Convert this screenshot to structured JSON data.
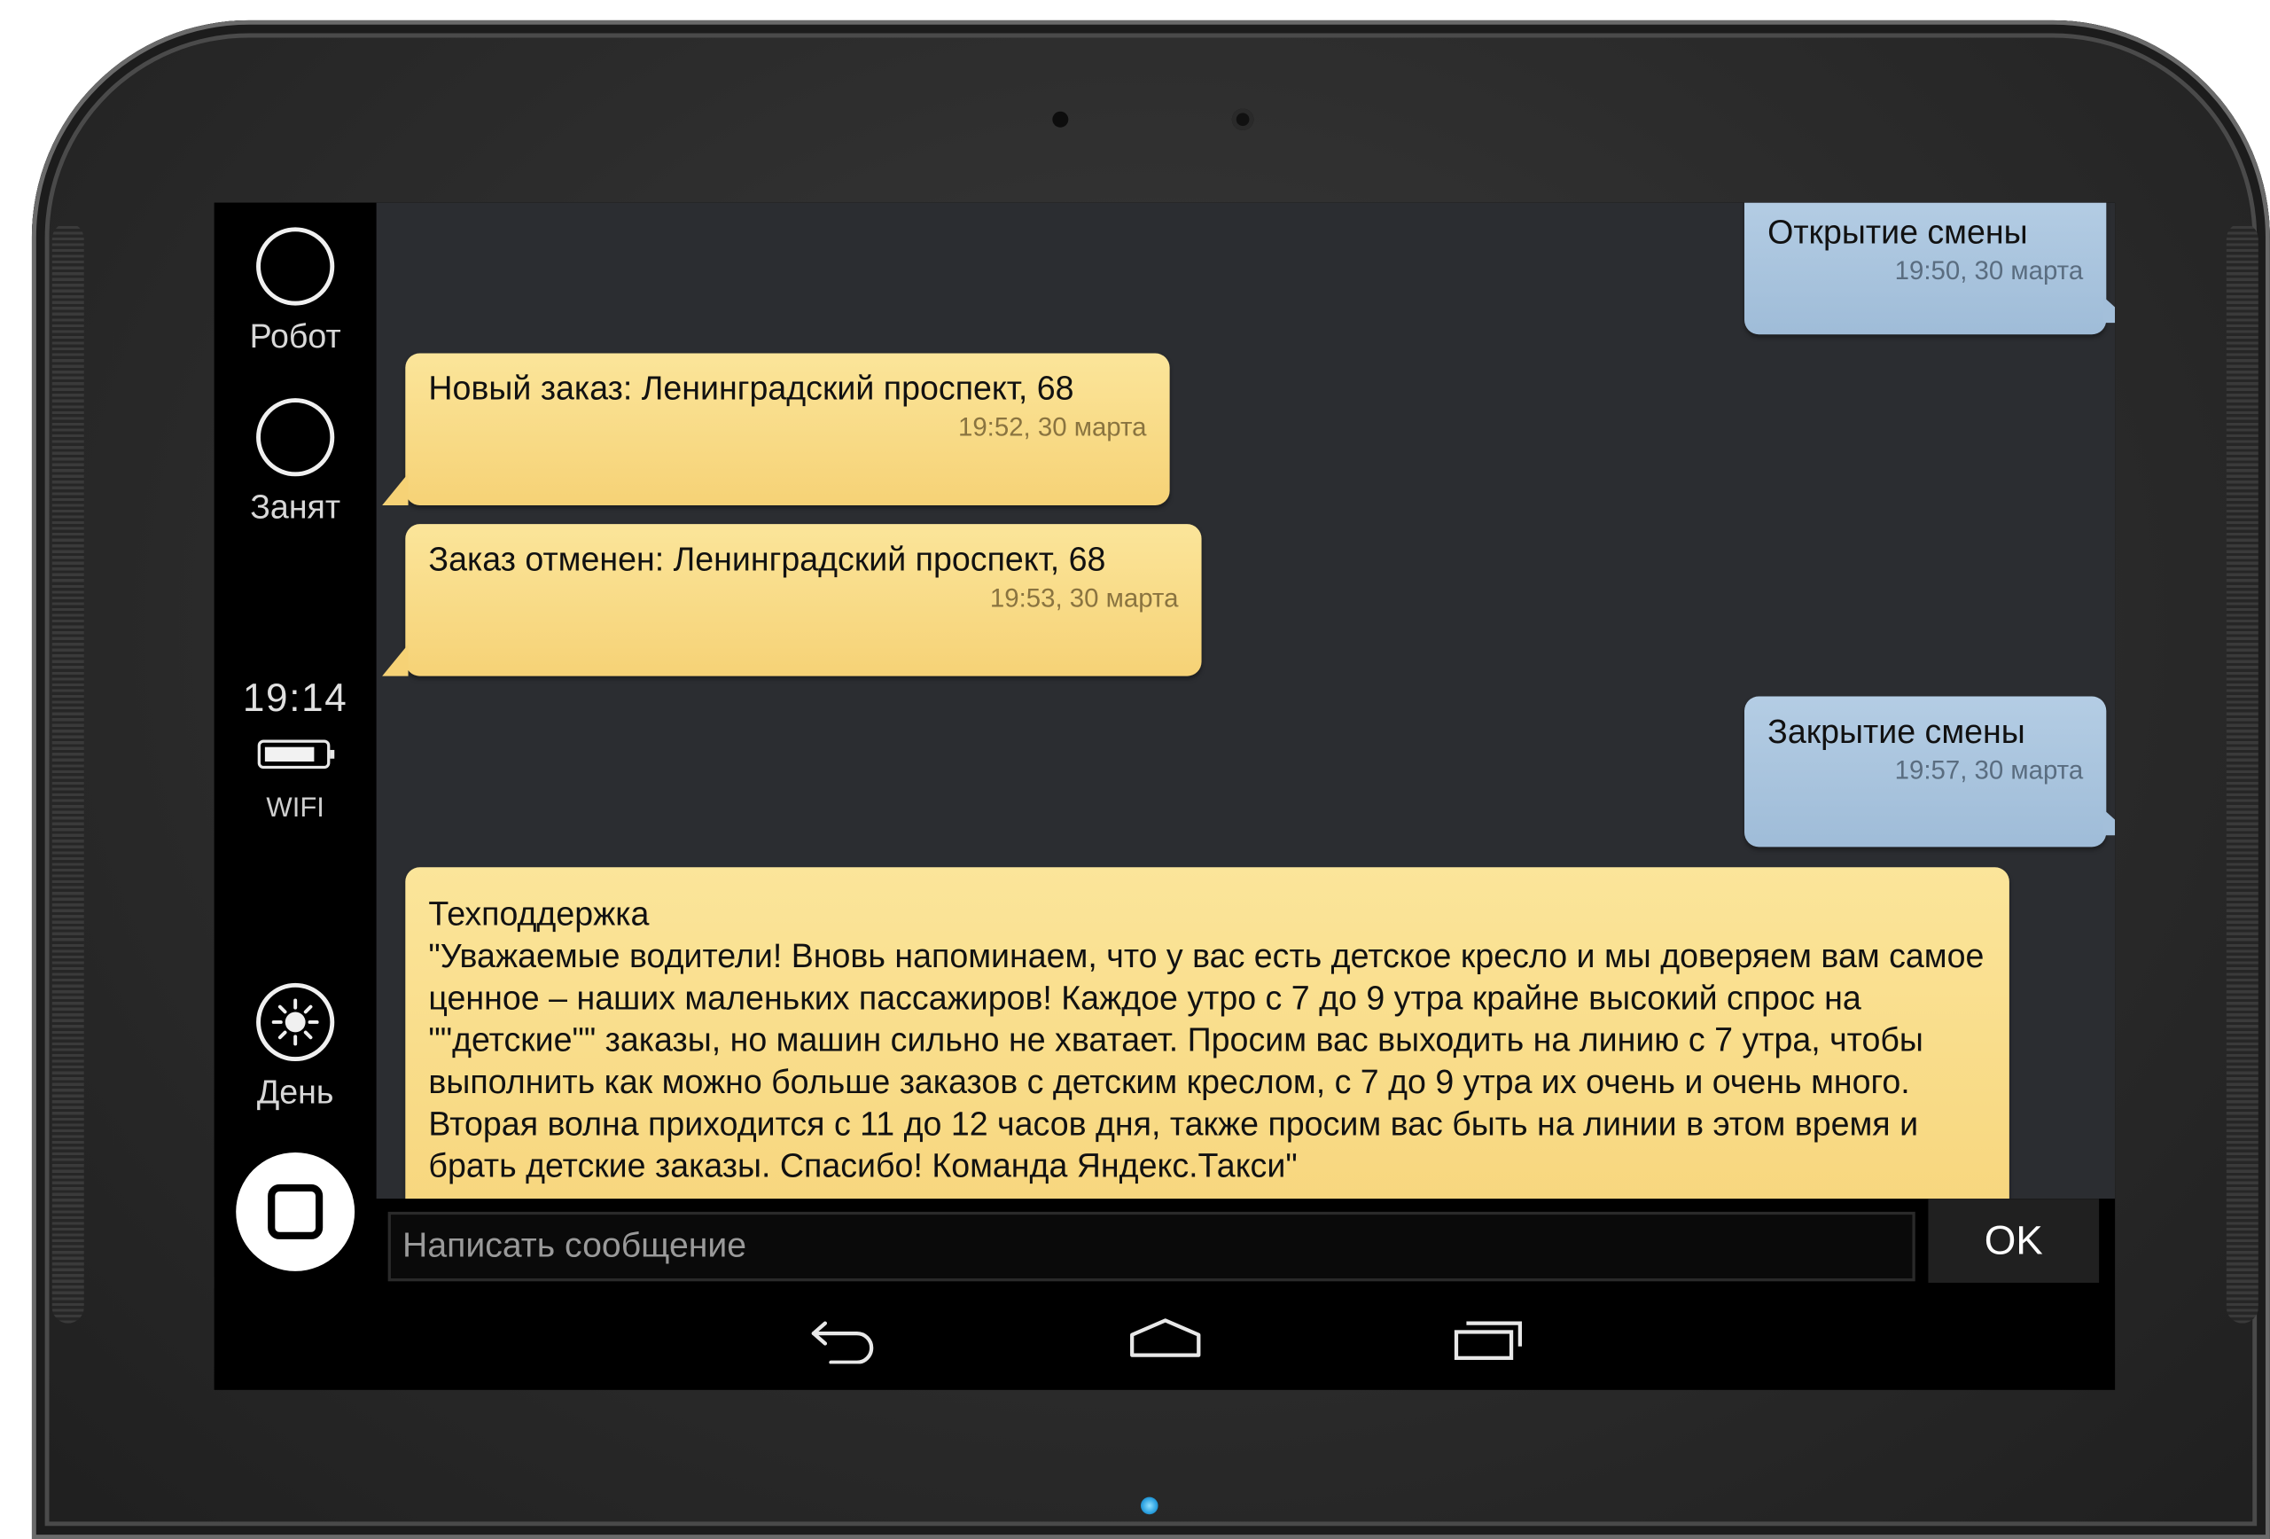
{
  "sidebar": {
    "robot_label": "Робот",
    "busy_label": "Занят",
    "time": "19:14",
    "network": "WIFI",
    "day_label": "День"
  },
  "messages": [
    {
      "direction": "outgoing",
      "text": "Открытие смены",
      "time": "19:50, 30 марта"
    },
    {
      "direction": "incoming",
      "text": "Новый заказ: Ленинградский проспект, 68",
      "time": "19:52, 30 марта"
    },
    {
      "direction": "incoming",
      "text": "Заказ отменен: Ленинградский проспект, 68",
      "time": "19:53, 30 марта"
    },
    {
      "direction": "outgoing",
      "text": "Закрытие смены",
      "time": "19:57, 30 марта"
    },
    {
      "direction": "incoming",
      "sender": "Техподдержка",
      "text": "\"Уважаемые водители! Вновь напоминаем, что у вас есть детское кресло и мы доверяем вам самое ценное – наших маленьких пассажиров! Каждое утро с 7 до 9 утра крайне высокий спрос на \"\"детские\"\" заказы, но машин сильно не хватает. Просим вас выходить на линию с 7 утра, чтобы выполнить как можно больше заказов с детским креслом, с 7 до 9 утра их очень и очень много. Вторая волна приходится с 11 до 12 часов дня, также просим вас быть на линии в этом время и брать детские заказы. Спасибо! Команда Яндекс.Такси\""
    }
  ],
  "composer": {
    "placeholder": "Написать сообщение",
    "send_label": "OK"
  },
  "icons": {
    "robot": "circle-icon",
    "busy": "circle-icon",
    "day": "sun-icon",
    "stop": "stop-icon",
    "back": "back-icon",
    "home": "home-icon",
    "recents": "recents-icon"
  },
  "colors": {
    "incoming_bubble": "#f6d276",
    "outgoing_bubble": "#a3bfda",
    "chat_background": "#2b2d31"
  }
}
